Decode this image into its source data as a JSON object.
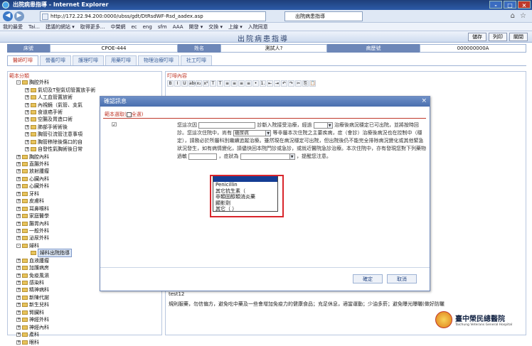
{
  "window": {
    "title": "出院病患指導 - Internet Explorer",
    "controls": [
      "-",
      "□",
      "×"
    ]
  },
  "browser": {
    "address": "http://172.22.94.200:0000/ubss/gdt/DtRsdWF-Rsd_aadex.asp",
    "tab_title": "出院病患指導",
    "favorites": [
      "我的最愛",
      "Tai...",
      "建議的網站 ▾",
      "取得更多...",
      "中榮網",
      "ec",
      "eng",
      "sfm",
      "AAA",
      "開發 ▾",
      "交換 ▾",
      "上線 ▾",
      "入院同意"
    ]
  },
  "app": {
    "title": "出院病患指導",
    "buttons": {
      "save": "儲存",
      "print": "列印",
      "close": "關閉"
    }
  },
  "patient": {
    "bed_label": "床號",
    "bed_value": "CPOE-444",
    "name_label": "姓名",
    "name_value": "測試人?",
    "chart_label": "病歷號",
    "chart_value": "000000000A"
  },
  "tabs": [
    "醫師叮嚀",
    "營養叮嚀",
    "護理叮嚀",
    "用藥叮嚀",
    "物理治療叮嚀",
    "社工叮嚀"
  ],
  "left_panel": {
    "header": "範本分類",
    "tree": [
      {
        "label": "胸腔外科",
        "depth": 0,
        "expander": "-"
      },
      {
        "label": "氣切及T型氣切管置放手術",
        "depth": 1,
        "expander": "+"
      },
      {
        "label": "人工血管置放術",
        "depth": 1,
        "expander": "+"
      },
      {
        "label": "內視鏡（氣管、支氣",
        "depth": 1,
        "expander": "+"
      },
      {
        "label": "食道癌手術",
        "depth": 1,
        "expander": "+"
      },
      {
        "label": "空腸及胃造口術",
        "depth": 1,
        "expander": "+"
      },
      {
        "label": "肺部手術術後",
        "depth": 1,
        "expander": "+"
      },
      {
        "label": "胸管引流管注意事項",
        "depth": 1,
        "expander": "+"
      },
      {
        "label": "胸管移除後傷口的自",
        "depth": 1,
        "expander": "+"
      },
      {
        "label": "自發性氣胸術後日常",
        "depth": 1,
        "expander": "+"
      },
      {
        "label": "胸腔內科",
        "depth": 0,
        "expander": "+"
      },
      {
        "label": "直腸外科",
        "depth": 0,
        "expander": "+"
      },
      {
        "label": "放射腫瘤",
        "depth": 0,
        "expander": "+"
      },
      {
        "label": "心臟內科",
        "depth": 0,
        "expander": "+"
      },
      {
        "label": "心臟外科",
        "depth": 0,
        "expander": "+"
      },
      {
        "label": "牙科",
        "depth": 0,
        "expander": "+"
      },
      {
        "label": "皮膚科",
        "depth": 0,
        "expander": "+"
      },
      {
        "label": "耳鼻喉科",
        "depth": 0,
        "expander": "+"
      },
      {
        "label": "家庭醫學",
        "depth": 0,
        "expander": "+"
      },
      {
        "label": "腸胃內科",
        "depth": 0,
        "expander": "+"
      },
      {
        "label": "一般外科",
        "depth": 0,
        "expander": "+"
      },
      {
        "label": "泌尿外科",
        "depth": 0,
        "expander": "+"
      },
      {
        "label": "婦科",
        "depth": 0,
        "expander": "-"
      },
      {
        "label": "婦科出院指導",
        "depth": 1,
        "expander": "",
        "selected": true
      },
      {
        "label": "血液腫瘤",
        "depth": 0,
        "expander": "+"
      },
      {
        "label": "加護病房",
        "depth": 0,
        "expander": "+"
      },
      {
        "label": "免疫風濕",
        "depth": 0,
        "expander": "+"
      },
      {
        "label": "感染科",
        "depth": 0,
        "expander": "+"
      },
      {
        "label": "精神病科",
        "depth": 0,
        "expander": "+"
      },
      {
        "label": "新陳代謝",
        "depth": 0,
        "expander": "+"
      },
      {
        "label": "新生兒科",
        "depth": 0,
        "expander": "+"
      },
      {
        "label": "腎臟科",
        "depth": 0,
        "expander": "+"
      },
      {
        "label": "神經外科",
        "depth": 0,
        "expander": "+"
      },
      {
        "label": "神經內科",
        "depth": 0,
        "expander": "+"
      },
      {
        "label": "產科",
        "depth": 0,
        "expander": "+"
      },
      {
        "label": "眼科",
        "depth": 0,
        "expander": "+"
      }
    ]
  },
  "right_panel": {
    "header": "叮嚀內容",
    "toolbar": [
      "B",
      "I",
      "U",
      "abc",
      "x₂",
      "x²",
      "T",
      "T",
      "≡",
      "≡",
      "≡",
      "≡",
      "•",
      "1.",
      "⇤",
      "⇥",
      "↶",
      "↷",
      "✂",
      "⎘",
      "📋"
    ],
    "footer_label": "test12",
    "footer_text": "規則服藥，勿信偏方，避免吃中藥及一些會增加免疫力的健康食品；充足休息，適當運動；少油多菸；避免曝光曝曬(做好防曬"
  },
  "modal": {
    "title": "確認訊息",
    "close": "×",
    "select_template": "範本選取(",
    "select_all": "全選",
    "select_close": ")",
    "check_mark": "☑",
    "text_1": "您這次因",
    "text_2": "診斷入院接受治療，經過",
    "text_3": "治療後病況穩定已可出院，並將按時回診。您這次住院中，尚有",
    "field_condition": "糖尿病",
    "text_4": "等非屬本次住院之主要疾病，症（會診）治療後病況也在控制中（穩定），請務必於所屬科別繼續追蹤治療。雖然現在病況穩定可出院，但出院後仍不能完全排除病況變化或其他緊急狀況發生，如有病情變化，請儘快回本院門診或急診，或就近醫院急診治療。本次住院中，亦有發現您對下列藥物過敏",
    "text_5": "，症狀為",
    "text_6": "，提醒您注意。",
    "dropdown_options": [
      "Penicillin",
      "其它抗生素（",
      "非類固醇類消炎藥",
      "顯影劑",
      "其它（   ）"
    ],
    "confirm": "確定",
    "cancel": "取消"
  },
  "logo": {
    "name": "臺中榮民總醫院",
    "english": "Taichung Veterans General Hospital"
  },
  "colors": {
    "accent": "#6d87b8",
    "highlight_red": "#d9252b",
    "selection_blue": "#143d94"
  }
}
